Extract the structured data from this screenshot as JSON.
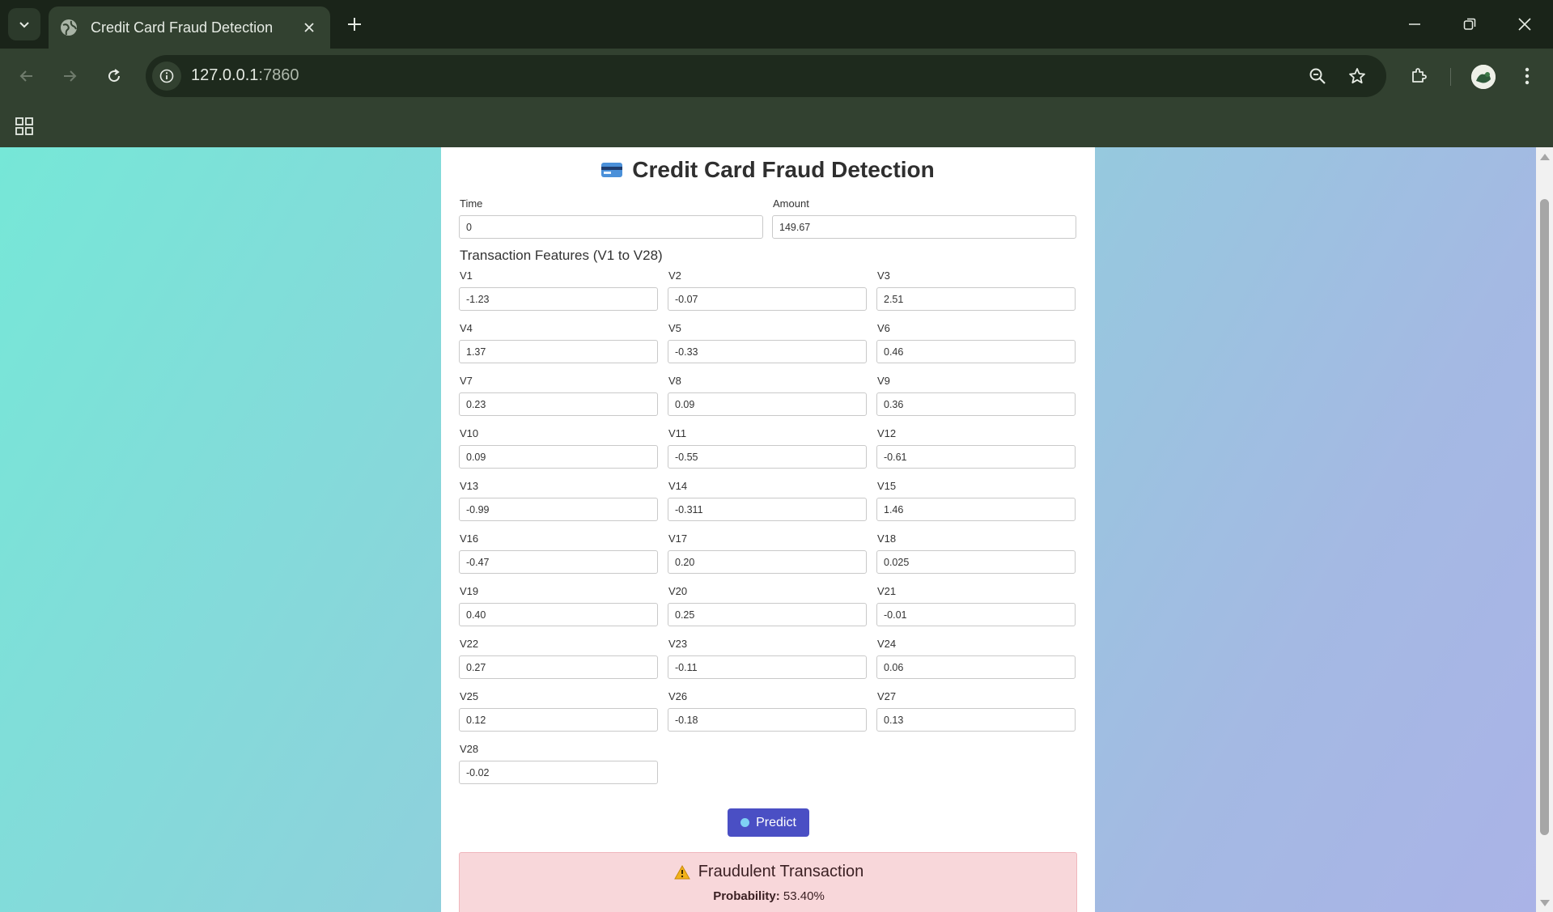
{
  "browser": {
    "tab_title": "Credit Card Fraud Detection",
    "url_host": "127.0.0.1",
    "url_port": ":7860"
  },
  "page": {
    "title": "Credit Card Fraud Detection",
    "time_label": "Time",
    "time_value": "0",
    "amount_label": "Amount",
    "amount_value": "149.67",
    "features_heading": "Transaction Features (V1 to V28)",
    "features": [
      {
        "label": "V1",
        "value": "-1.23"
      },
      {
        "label": "V2",
        "value": "-0.07"
      },
      {
        "label": "V3",
        "value": "2.51"
      },
      {
        "label": "V4",
        "value": "1.37"
      },
      {
        "label": "V5",
        "value": "-0.33"
      },
      {
        "label": "V6",
        "value": "0.46"
      },
      {
        "label": "V7",
        "value": "0.23"
      },
      {
        "label": "V8",
        "value": "0.09"
      },
      {
        "label": "V9",
        "value": "0.36"
      },
      {
        "label": "V10",
        "value": "0.09"
      },
      {
        "label": "V11",
        "value": "-0.55"
      },
      {
        "label": "V12",
        "value": "-0.61"
      },
      {
        "label": "V13",
        "value": "-0.99"
      },
      {
        "label": "V14",
        "value": "-0.311"
      },
      {
        "label": "V15",
        "value": "1.46"
      },
      {
        "label": "V16",
        "value": "-0.47"
      },
      {
        "label": "V17",
        "value": "0.20"
      },
      {
        "label": "V18",
        "value": "0.025"
      },
      {
        "label": "V19",
        "value": "0.40"
      },
      {
        "label": "V20",
        "value": "0.25"
      },
      {
        "label": "V21",
        "value": "-0.01"
      },
      {
        "label": "V22",
        "value": "0.27"
      },
      {
        "label": "V23",
        "value": "-0.11"
      },
      {
        "label": "V24",
        "value": "0.06"
      },
      {
        "label": "V25",
        "value": "0.12"
      },
      {
        "label": "V26",
        "value": "-0.18"
      },
      {
        "label": "V27",
        "value": "0.13"
      },
      {
        "label": "V28",
        "value": "-0.02"
      }
    ],
    "predict_label": "Predict",
    "result": {
      "title": "Fraudulent Transaction",
      "prob_label": "Probability:",
      "prob_value": "53.40%"
    }
  },
  "colors": {
    "accent": "#4a4fc4",
    "result_bg": "#f8d7da"
  }
}
